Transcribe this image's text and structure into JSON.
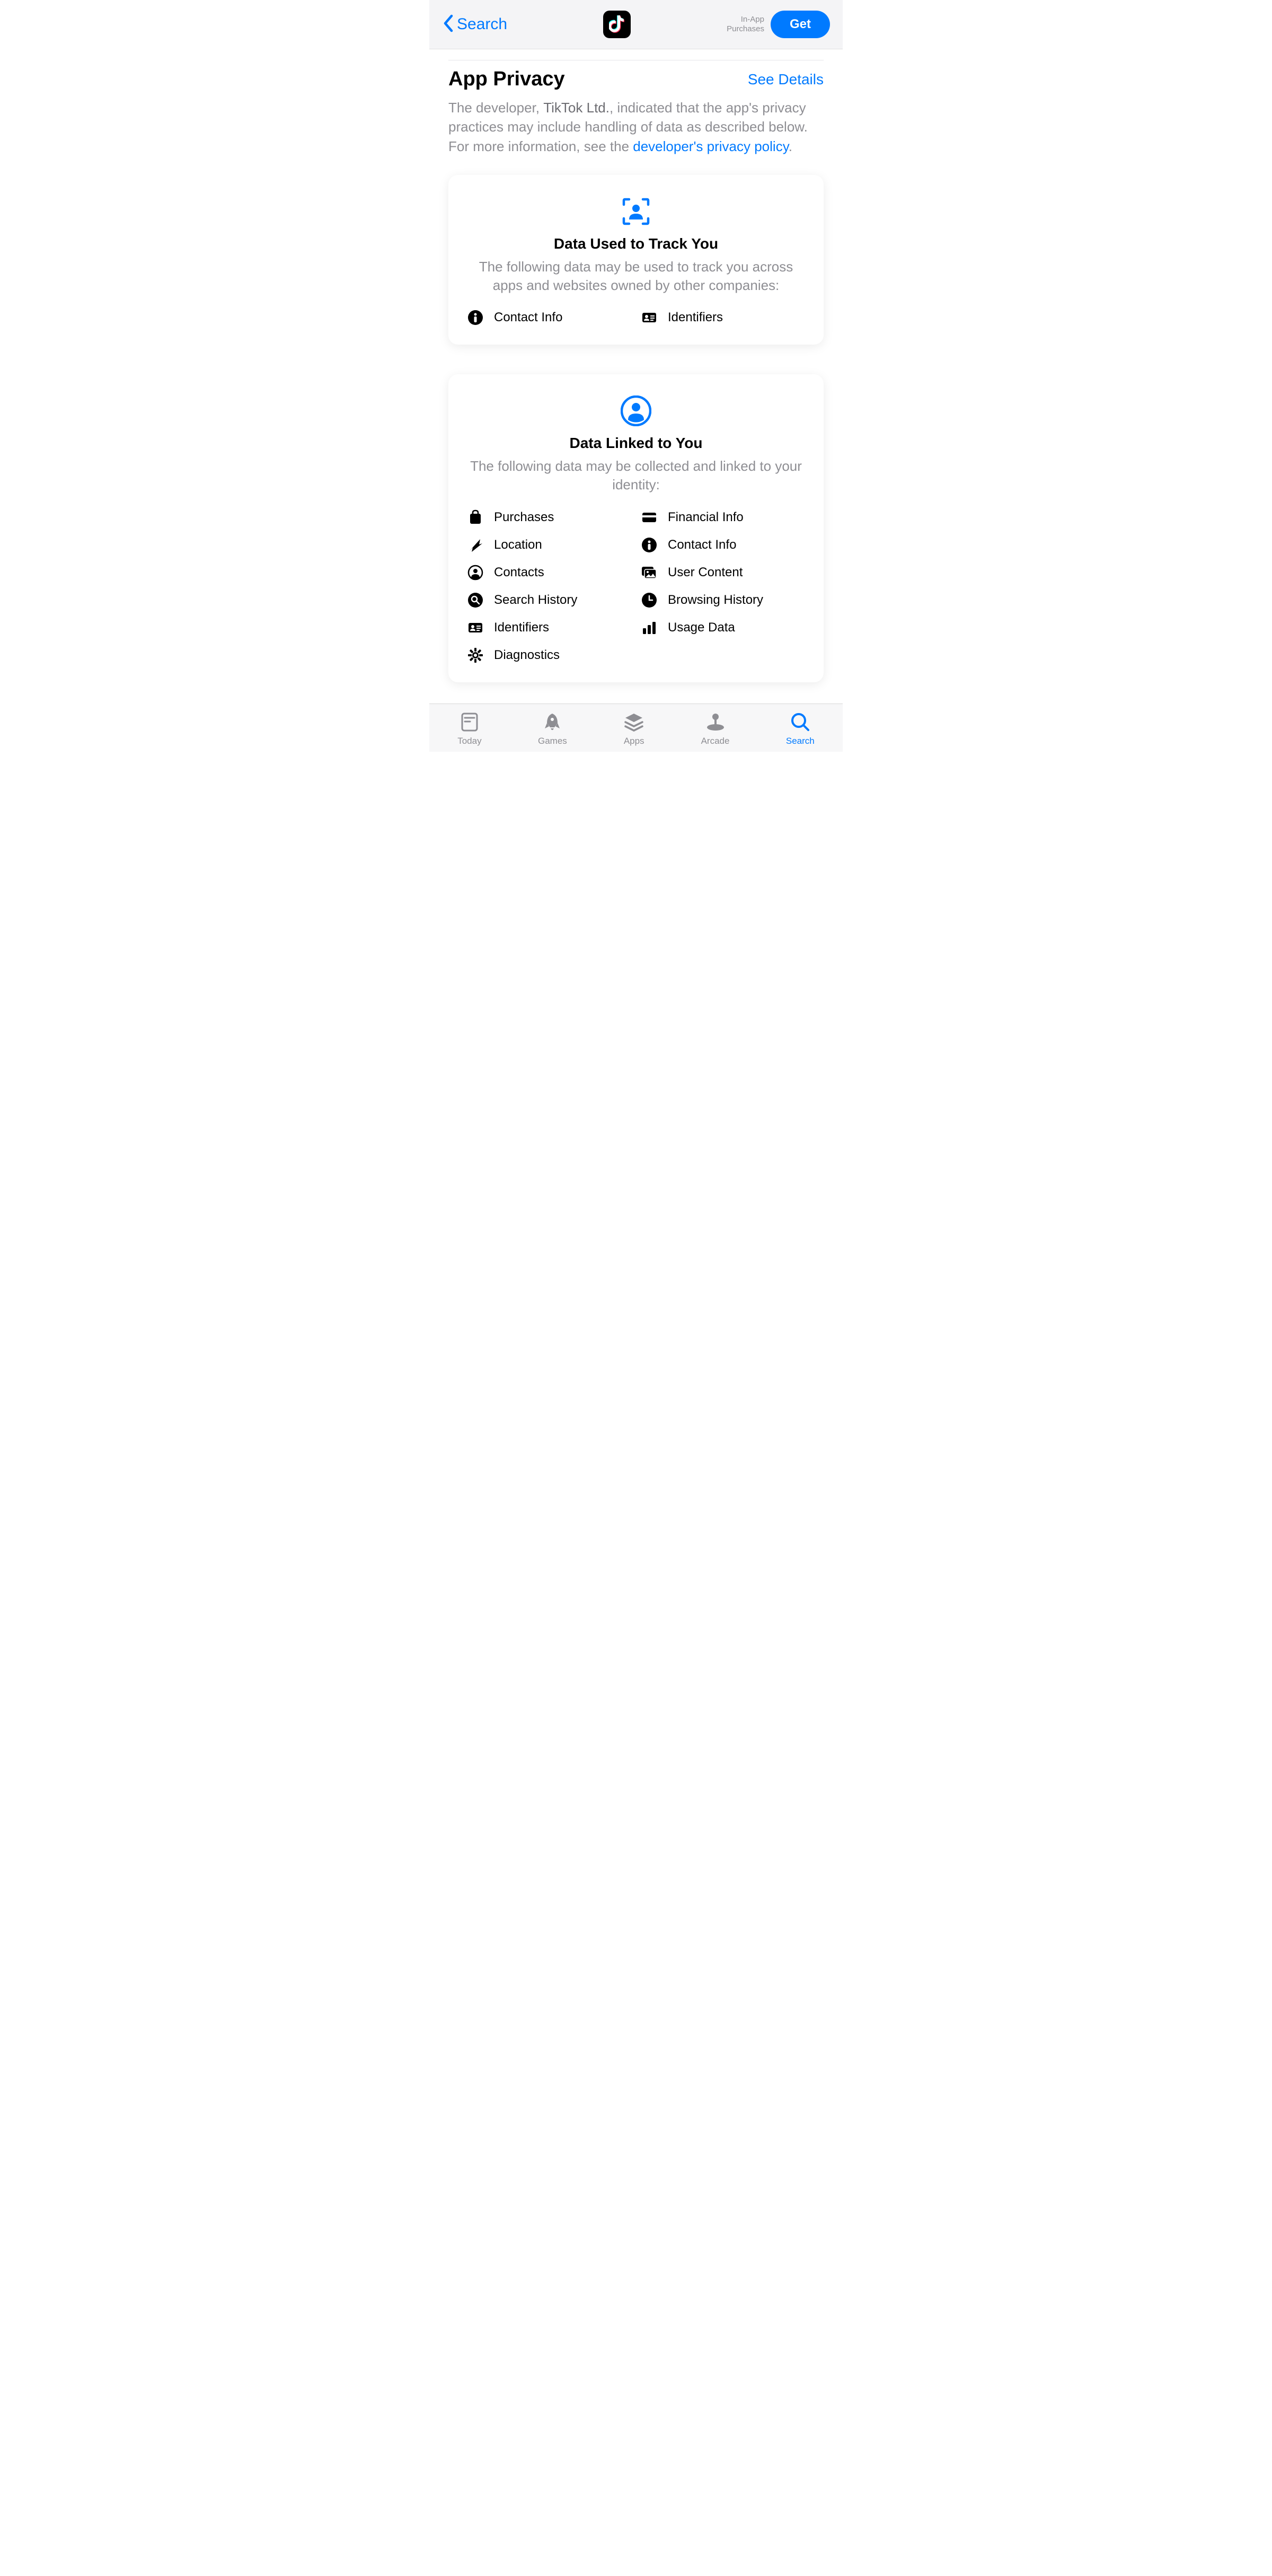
{
  "header": {
    "back_label": "Search",
    "iap_label": "In-App\nPurchases",
    "get_label": "Get"
  },
  "section": {
    "title": "App Privacy",
    "see_details": "See Details",
    "desc_pre": "The developer, ",
    "dev_name": "TikTok Ltd.",
    "desc_mid": ", indicated that the app's privacy practices may include handling of data as described below. For more information, see the ",
    "policy_link": "developer's privacy policy",
    "desc_end": "."
  },
  "card_track": {
    "title": "Data Used to Track You",
    "desc": "The following data may be used to track you across apps and websites owned by other companies:",
    "items": [
      {
        "icon": "info",
        "label": "Contact Info"
      },
      {
        "icon": "id",
        "label": "Identifiers"
      }
    ]
  },
  "card_linked": {
    "title": "Data Linked to You",
    "desc": "The following data may be collected and linked to your identity:",
    "items": [
      {
        "icon": "bag",
        "label": "Purchases"
      },
      {
        "icon": "card",
        "label": "Financial Info"
      },
      {
        "icon": "arrow",
        "label": "Location"
      },
      {
        "icon": "info",
        "label": "Contact Info"
      },
      {
        "icon": "person-circle",
        "label": "Contacts"
      },
      {
        "icon": "photo",
        "label": "User Content"
      },
      {
        "icon": "search-circle",
        "label": "Search History"
      },
      {
        "icon": "clock",
        "label": "Browsing History"
      },
      {
        "icon": "id",
        "label": "Identifiers"
      },
      {
        "icon": "chart",
        "label": "Usage Data"
      },
      {
        "icon": "gear",
        "label": "Diagnostics"
      }
    ]
  },
  "tabs": [
    {
      "icon": "today",
      "label": "Today"
    },
    {
      "icon": "rocket",
      "label": "Games"
    },
    {
      "icon": "stack",
      "label": "Apps"
    },
    {
      "icon": "arcade",
      "label": "Arcade"
    },
    {
      "icon": "search",
      "label": "Search",
      "active": true
    }
  ],
  "colors": {
    "accent": "#007aff",
    "gray": "#8e8e93"
  }
}
